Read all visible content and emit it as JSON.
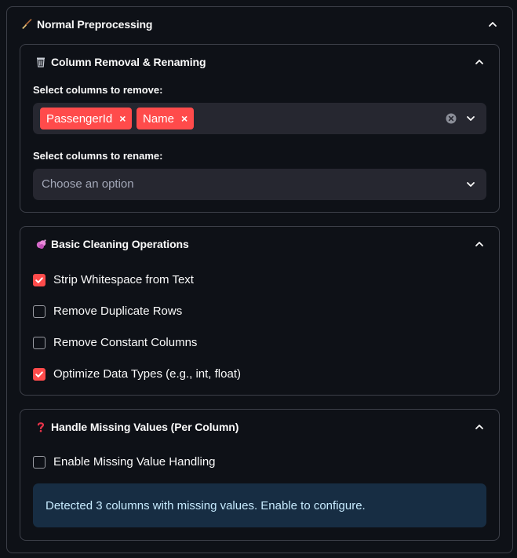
{
  "expander": {
    "title": "Normal Preprocessing",
    "icon": "broom-icon",
    "expanded": true
  },
  "column_section": {
    "title": "Column Removal & Renaming",
    "icon": "wastebasket-icon",
    "remove_label": "Select columns to remove:",
    "remove_selected": [
      "PassengerId",
      "Name"
    ],
    "rename_label": "Select columns to rename:",
    "rename_placeholder": "Choose an option"
  },
  "cleaning_section": {
    "title": "Basic Cleaning Operations",
    "icon": "sparkle-bubble-icon",
    "options": [
      {
        "label": "Strip Whitespace from Text",
        "checked": true
      },
      {
        "label": "Remove Duplicate Rows",
        "checked": false
      },
      {
        "label": "Remove Constant Columns",
        "checked": false
      },
      {
        "label": "Optimize Data Types (e.g., int, float)",
        "checked": true
      }
    ]
  },
  "missing_section": {
    "title": "Handle Missing Values (Per Column)",
    "icon": "question-mark-icon",
    "enable_label": "Enable Missing Value Handling",
    "enable_checked": false,
    "info_text": "Detected 3 columns with missing values. Enable to configure."
  },
  "colors": {
    "accent": "#ff4b4b",
    "background": "#0e1117",
    "input_bg": "#262730",
    "info_bg": "#172d43",
    "info_text": "#c7ebff"
  }
}
